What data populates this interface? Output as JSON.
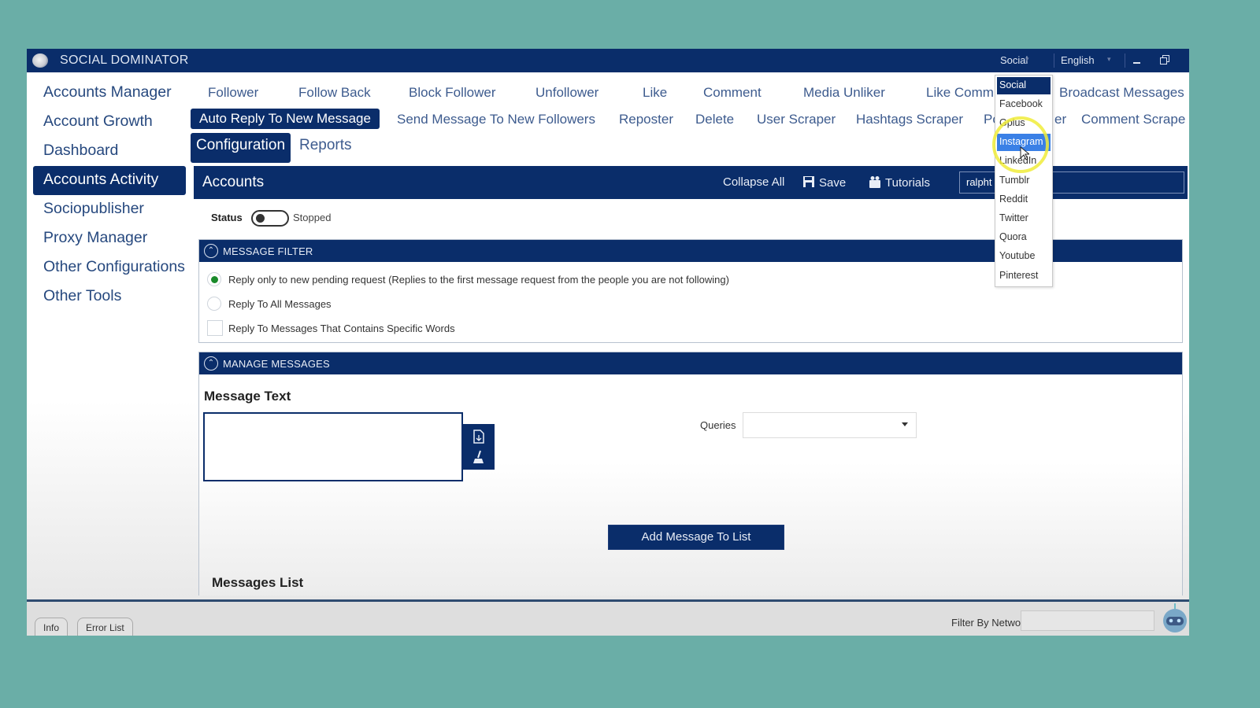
{
  "titlebar": {
    "app_title": "SOCIAL DOMINATOR",
    "network_select": "Social",
    "language_select": "English"
  },
  "sidebar": {
    "items": [
      {
        "label": "Accounts Manager"
      },
      {
        "label": "Account Growth"
      },
      {
        "label": "Dashboard"
      },
      {
        "label": "Accounts Activity",
        "active": true
      },
      {
        "label": "Sociopublisher"
      },
      {
        "label": "Proxy Manager"
      },
      {
        "label": "Other Configurations"
      },
      {
        "label": "Other Tools"
      }
    ]
  },
  "menu": {
    "row1": [
      "Follower",
      "Follow Back",
      "Block Follower",
      "Unfollower",
      "Like",
      "Comment",
      "Media Unliker",
      "Like Comm",
      "Broadcast Messages"
    ],
    "row2": [
      "Auto Reply To New Message",
      "Send Message To New Followers",
      "Reposter",
      "Delete",
      "User Scraper",
      "Hashtags Scraper",
      "Po",
      "er",
      "Comment Scrape"
    ],
    "active": "Auto Reply To New Message"
  },
  "subtabs": [
    "Configuration",
    "Reports"
  ],
  "accounts_bar": {
    "title": "Accounts",
    "collapse_all": "Collapse All",
    "save": "Save",
    "tutorials": "Tutorials",
    "account_value": "ralpht"
  },
  "status": {
    "label": "Status",
    "value": "Stopped",
    "running": false
  },
  "message_filter": {
    "title": "MESSAGE FILTER",
    "options": [
      {
        "label": "Reply only to new pending request (Replies to the first message request from the people you are not following)",
        "type": "radio",
        "selected": true
      },
      {
        "label": "Reply To All Messages",
        "type": "radio",
        "selected": false
      },
      {
        "label": "Reply To Messages That Contains Specific Words",
        "type": "checkbox",
        "checked": false
      }
    ]
  },
  "manage_messages": {
    "title": "MANAGE MESSAGES",
    "message_text_label": "Message Text",
    "message_text_value": "",
    "queries_label": "Queries",
    "queries_value": "",
    "add_button": "Add Message To List",
    "messages_list_label": "Messages List"
  },
  "bottom": {
    "tabs": [
      "Info",
      "Error List"
    ],
    "filter_label": "Filter By Network",
    "filter_value": ""
  },
  "network_dropdown": {
    "items": [
      "Social",
      "Facebook",
      "Gplus",
      "Instagram",
      "LinkedIn",
      "Tumblr",
      "Reddit",
      "Twitter",
      "Quora",
      "Youtube",
      "Pinterest"
    ],
    "selected": "Social",
    "hovered": "Instagram"
  },
  "colors": {
    "primary": "#0a2d6a",
    "background": "#6aaea7",
    "hover": "#3a80e6",
    "radio_selected": "#1a8a2a",
    "highlight": "#f0ec3a"
  }
}
